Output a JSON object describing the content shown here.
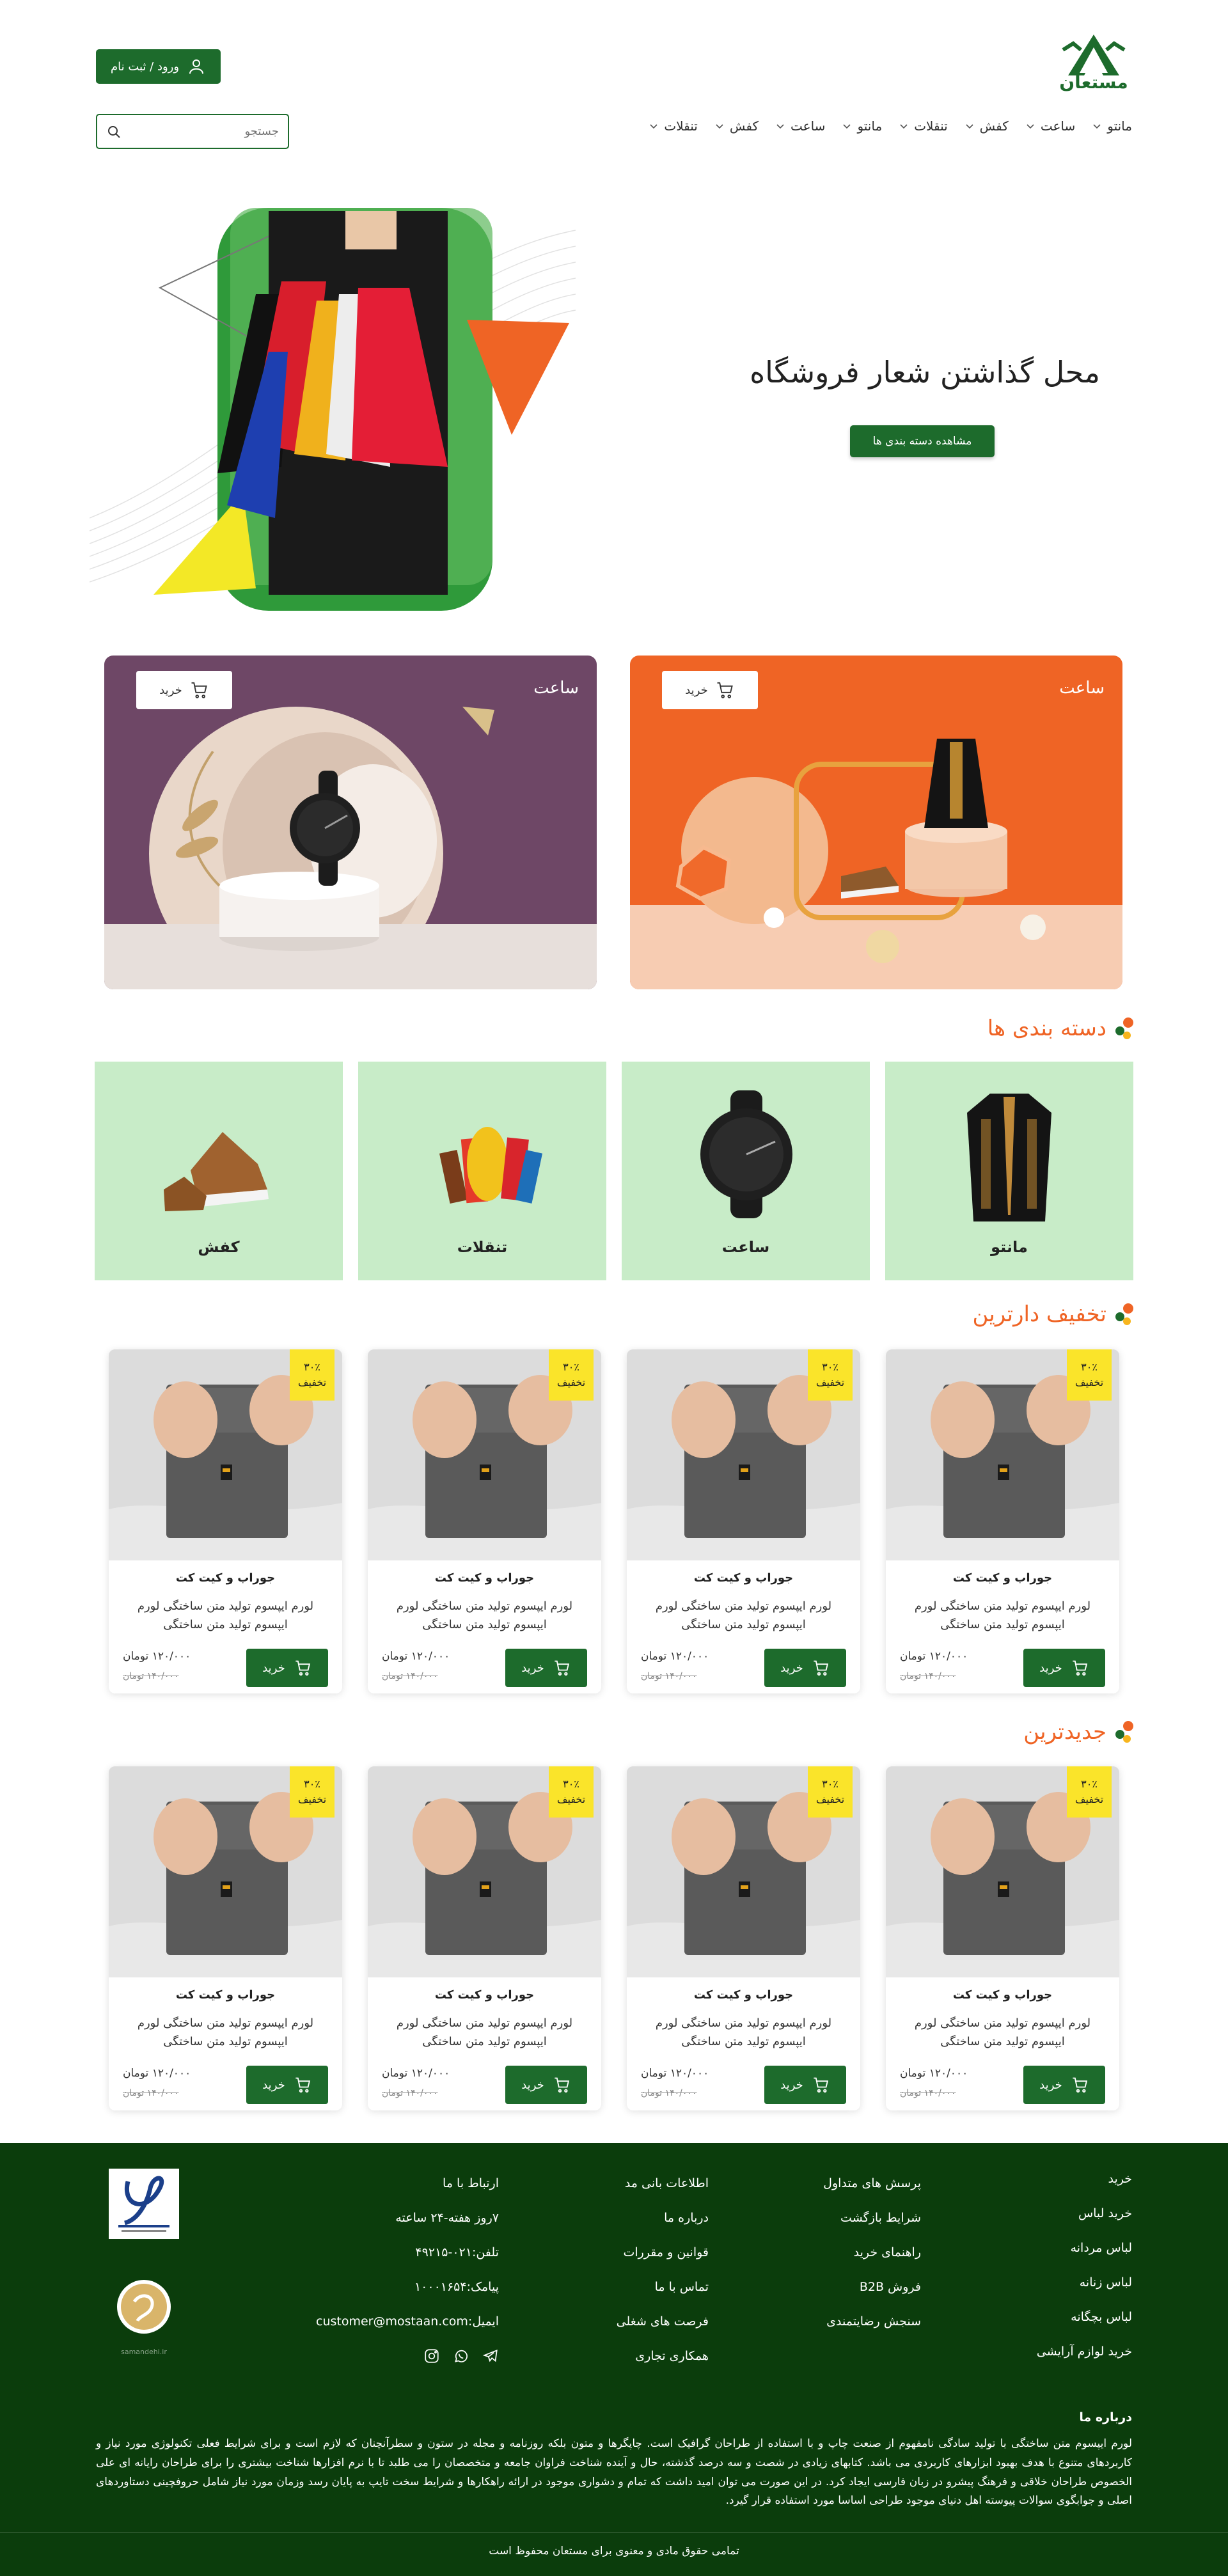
{
  "brand": {
    "name": "مستعان",
    "primary": "#1d6b2c",
    "accent": "#ef6425",
    "footer_bg": "#0b3d0c"
  },
  "header": {
    "login_label": "ورود / ثبت نام",
    "search_placeholder": "جستجو",
    "nav": [
      "مانتو",
      "ساعت",
      "کفش",
      "تنقلات",
      "مانتو",
      "ساعت",
      "کفش",
      "تنقلات"
    ]
  },
  "hero": {
    "title": "محل گذاشتن شعار فروشگاه",
    "button": "مشاهده دسته بندی ها"
  },
  "promos": [
    {
      "title": "ساعت",
      "buy": "خرید",
      "bg": "#ef6425"
    },
    {
      "title": "ساعت",
      "buy": "خرید",
      "bg": "#6e4766"
    }
  ],
  "categories": {
    "title": "دسته بندی ها",
    "items": [
      {
        "label": "مانتو",
        "icon": "manto-image"
      },
      {
        "label": "ساعت",
        "icon": "watch-image"
      },
      {
        "label": "تنقلات",
        "icon": "snacks-image"
      },
      {
        "label": "کفش",
        "icon": "shoe-image"
      }
    ]
  },
  "discounted": {
    "title": "تخفیف دارترین",
    "products": [
      {
        "name": "جوراب و کیت کت",
        "desc": "لورم ایپسوم تولید متن ساختگی لورم ایپسوم تولید متن ساختگی",
        "badge_pct": "۳۰٪",
        "badge_label": "تخفیف",
        "price": "۱۲۰/۰۰۰ تومان",
        "old_price": "۱۴۰/۰۰۰ تومان",
        "buy": "خرید"
      },
      {
        "name": "جوراب و کیت کت",
        "desc": "لورم ایپسوم تولید متن ساختگی لورم ایپسوم تولید متن ساختگی",
        "badge_pct": "۳۰٪",
        "badge_label": "تخفیف",
        "price": "۱۲۰/۰۰۰ تومان",
        "old_price": "۱۴۰/۰۰۰ تومان",
        "buy": "خرید"
      },
      {
        "name": "جوراب و کیت کت",
        "desc": "لورم ایپسوم تولید متن ساختگی لورم ایپسوم تولید متن ساختگی",
        "badge_pct": "۳۰٪",
        "badge_label": "تخفیف",
        "price": "۱۲۰/۰۰۰ تومان",
        "old_price": "۱۴۰/۰۰۰ تومان",
        "buy": "خرید"
      },
      {
        "name": "جوراب و کیت کت",
        "desc": "لورم ایپسوم تولید متن ساختگی لورم ایپسوم تولید متن ساختگی",
        "badge_pct": "۳۰٪",
        "badge_label": "تخفیف",
        "price": "۱۲۰/۰۰۰ تومان",
        "old_price": "۱۴۰/۰۰۰ تومان",
        "buy": "خرید"
      }
    ]
  },
  "newest": {
    "title": "جدیدترین",
    "products": [
      {
        "name": "جوراب و کیت کت",
        "desc": "لورم ایپسوم تولید متن ساختگی لورم ایپسوم تولید متن ساختگی",
        "badge_pct": "۳۰٪",
        "badge_label": "تخفیف",
        "price": "۱۲۰/۰۰۰ تومان",
        "old_price": "۱۴۰/۰۰۰ تومان",
        "buy": "خرید"
      },
      {
        "name": "جوراب و کیت کت",
        "desc": "لورم ایپسوم تولید متن ساختگی لورم ایپسوم تولید متن ساختگی",
        "badge_pct": "۳۰٪",
        "badge_label": "تخفیف",
        "price": "۱۲۰/۰۰۰ تومان",
        "old_price": "۱۴۰/۰۰۰ تومان",
        "buy": "خرید"
      },
      {
        "name": "جوراب و کیت کت",
        "desc": "لورم ایپسوم تولید متن ساختگی لورم ایپسوم تولید متن ساختگی",
        "badge_pct": "۳۰٪",
        "badge_label": "تخفیف",
        "price": "۱۲۰/۰۰۰ تومان",
        "old_price": "۱۴۰/۰۰۰ تومان",
        "buy": "خرید"
      },
      {
        "name": "جوراب و کیت کت",
        "desc": "لورم ایپسوم تولید متن ساختگی لورم ایپسوم تولید متن ساختگی",
        "badge_pct": "۳۰٪",
        "badge_label": "تخفیف",
        "price": "۱۲۰/۰۰۰ تومان",
        "old_price": "۱۴۰/۰۰۰ تومان",
        "buy": "خرید"
      }
    ]
  },
  "footer": {
    "shop_links": [
      "خرید",
      "خرید لباس",
      "لباس مردانه",
      "لباس زنانه",
      "لباس بچگانه",
      "خرید لوازم آرایشی"
    ],
    "help_links": [
      "پرسش های متداول",
      "شرایط بازگشت",
      "راهنمای خرید",
      "فروش B2B",
      "سنجش رضایتمندی"
    ],
    "info_title": "اطلاعات بانی مد",
    "info_links": [
      "درباره ما",
      "قوانین و مقررات",
      "تماس با ما",
      "فرصت های شغلی",
      "همکاری تجاری"
    ],
    "contact_title": "ارتباط با ما",
    "contact_lines": [
      "۷روز هفته-۲۴ ساعته",
      "تلفن:۰۲۱-۴۹۲۱۵",
      "پیامک:۱۰۰۰۱۶۵۴",
      "ایمیل:customer@mostaan.com"
    ],
    "social_icons": [
      "telegram-icon",
      "whatsapp-icon",
      "instagram-icon"
    ],
    "enamad_text": "samandehi.ir",
    "about_title": "درباره ما",
    "about_text": "لورم ایپسوم متن ساختگی با تولید سادگی نامفهوم از صنعت چاپ و با استفاده از طراحان گرافیک است. چاپگرها و متون بلکه روزنامه و مجله در ستون و سطرآنچنان که لازم است و برای شرایط فعلی تکنولوژی مورد نیاز و کاربردهای متنوع با هدف بهبود ابزارهای کاربردی می باشد. کتابهای زیادی در شصت و سه درصد گذشته، حال و آینده شناخت فراوان جامعه و متخصصان را می طلبد تا با نرم افزارها شناخت بیشتری را برای طراحان رایانه ای علی الخصوص طراحان خلاقی و فرهنگ پیشرو در زبان فارسی ایجاد کرد. در این صورت می توان امید داشت که تمام و دشواری موجود در ارائه راهکارها و شرایط سخت تایپ به پایان رسد وزمان مورد نیاز شامل حروفچینی دستاوردهای اصلی و جوابگوی سوالات پیوسته اهل دنیای موجود طراحی اساسا مورد استفاده قرار گیرد.",
    "copyright": "تمامی حقوق مادی و معنوی برای مستعان محفوظ است"
  }
}
